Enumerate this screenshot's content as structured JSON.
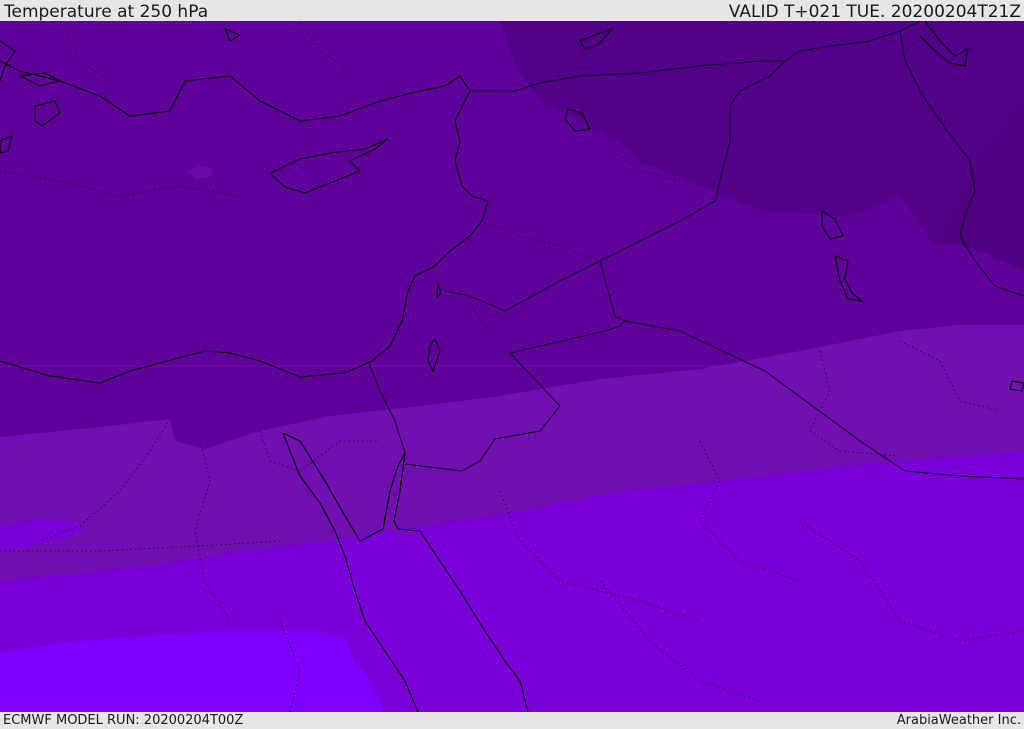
{
  "header": {
    "title": "Temperature at 250 hPa",
    "valid_time": "VALID T+021 TUE. 20200204T21Z"
  },
  "footer": {
    "model_run": "ECMWF MODEL RUN: 20200204T00Z",
    "credit": "ArabiaWeather Inc."
  },
  "colors": {
    "band_coldest": "#52008a",
    "band_cold": "#5f009a",
    "band_mid": "#7010b0",
    "band_warm": "#7a00d8",
    "band_warmest": "#8000ff",
    "coastline": "#000000",
    "border": "#1a0030"
  }
}
